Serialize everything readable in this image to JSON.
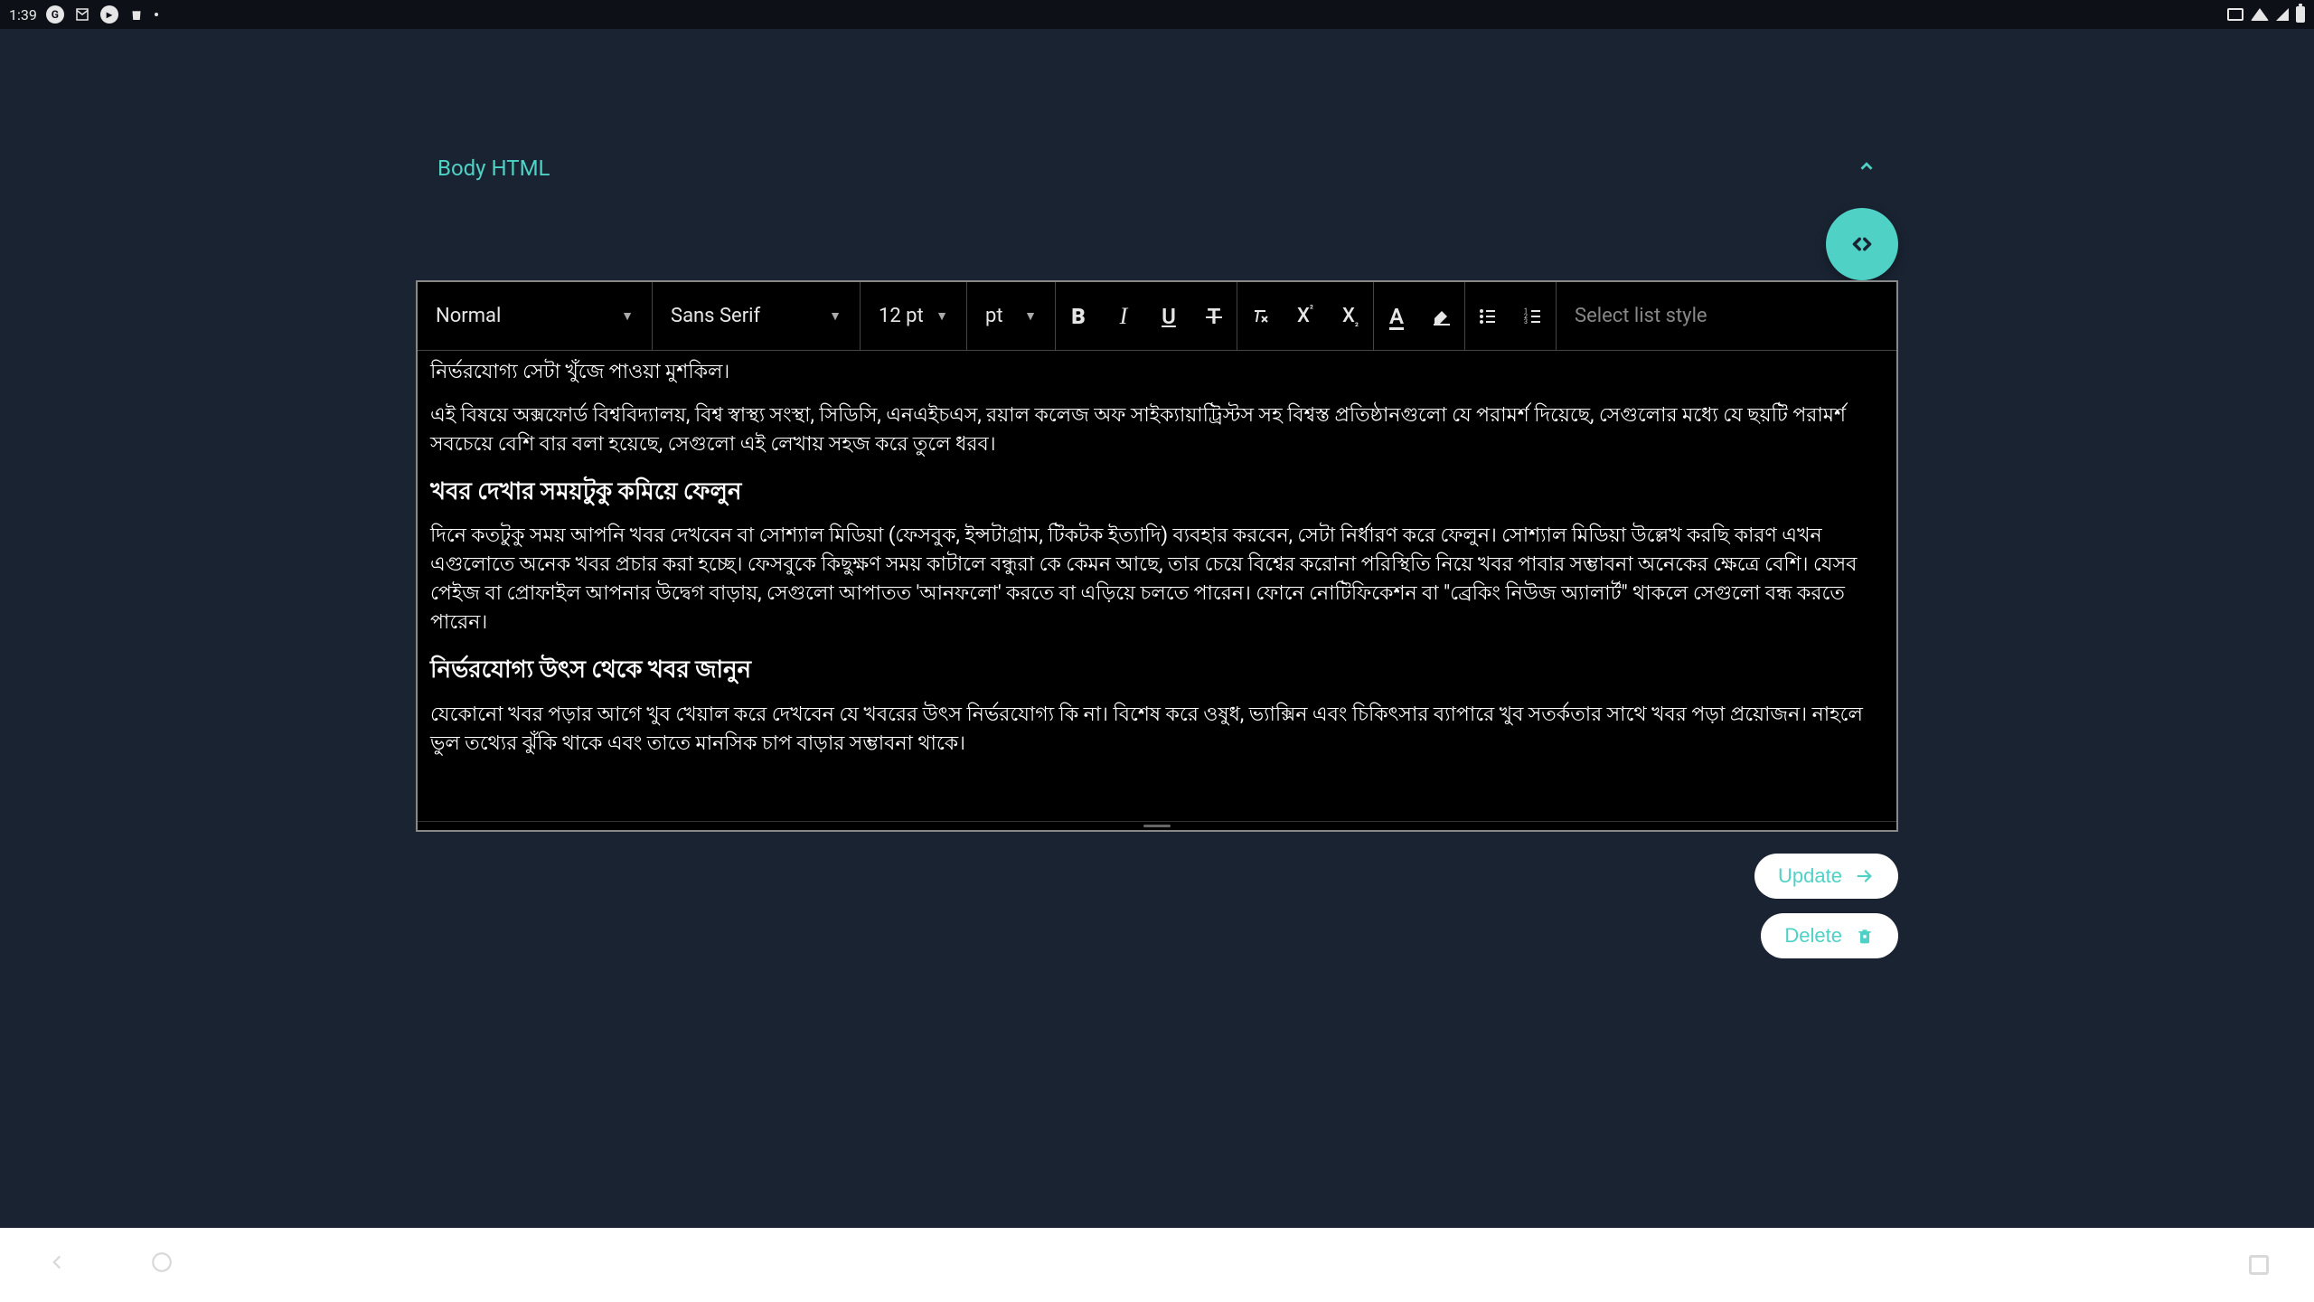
{
  "statusbar": {
    "time": "1:39",
    "icons": {
      "google": "G",
      "mail": "✉",
      "play": "▶",
      "store": "◫"
    }
  },
  "section": {
    "title": "Body HTML"
  },
  "toolbar": {
    "paragraph_style": "Normal",
    "font_family": "Sans Serif",
    "font_size": "12 pt",
    "size_unit": "pt",
    "bold": "B",
    "italic": "I",
    "underline": "U",
    "strike": "T",
    "superscript_base": "X",
    "subscript_base": "X",
    "text_color": "A",
    "list_style_placeholder": "Select list style"
  },
  "content": {
    "p_trunc_top": "নির্ভরযোগ্য সেটা খুঁজে পাওয়া মুশকিল।",
    "p_sources": "এই বিষয়ে অক্সফোর্ড বিশ্ববিদ্যালয়, বিশ্ব স্বাস্থ্য সংস্থা, সিডিসি, এনএইচএস, রয়াল কলেজ অফ সাইক্যায়াট্রিস্টস সহ বিশ্বস্ত প্রতিষ্ঠানগুলো যে পরামর্শ দিয়েছে, সেগুলোর মধ্যে যে ছয়টি পরামর্শ সবচেয়ে বেশি বার বলা হয়েছে, সেগুলো এই লেখায় সহজ করে তুলে ধরব।",
    "h_reduce_news": "খবর দেখার সময়টুকু কমিয়ে ফেলুন",
    "p_reduce_news": "দিনে কতটুকু সময় আপনি খবর দেখবেন বা সোশ্যাল মিডিয়া (ফেসবুক, ইন্সটাগ্রাম, টিকটক ইত্যাদি) ব্যবহার করবেন, সেটা নির্ধারণ করে ফেলুন। সোশ্যাল মিডিয়া উল্লেখ করছি কারণ এখন এগুলোতে অনেক খবর প্রচার করা হচ্ছে। ফেসবুকে কিছুক্ষণ সময় কাটালে বন্ধুরা কে কেমন আছে, তার চেয়ে বিশ্বের করোনা পরিস্থিতি নিয়ে খবর পাবার সম্ভাবনা অনেকের ক্ষেত্রে বেশি। যেসব পেইজ বা প্রোফাইল আপনার উদ্বেগ বাড়ায়, সেগুলো আপাতত 'আনফলো' করতে বা এড়িয়ে চলতে পারেন। ফোনে নোটিফিকেশন বা \"ব্রেকিং নিউজ অ্যালার্ট\" থাকলে সেগুলো বন্ধ করতে পারেন।",
    "h_reliable_sources": "নির্ভরযোগ্য উৎস থেকে খবর জানুন",
    "p_reliable_sources": "যেকোনো খবর পড়ার আগে খুব খেয়াল করে দেখবেন যে খবরের উৎস নির্ভরযোগ্য কি না। বিশেষ করে ওষুধ, ভ্যাক্সিন এবং চিকিৎসার ব্যাপারে খুব সতর্কতার সাথে খবর পড়া প্রয়োজন। নাহলে ভুল তথ্যের ঝুঁকি থাকে এবং তাতে মানসিক চাপ বাড়ার সম্ভাবনা থাকে।"
  },
  "buttons": {
    "update": "Update",
    "delete": "Delete"
  }
}
